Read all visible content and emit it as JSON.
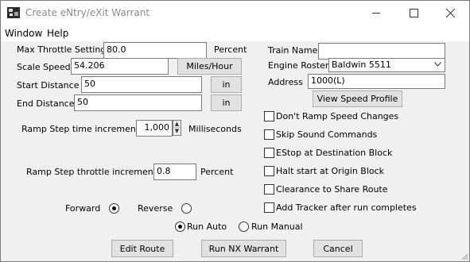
{
  "window": {
    "title": "Create eNtry/eXit Warrant"
  },
  "menu": [
    "Window",
    "Help"
  ],
  "throttle": {
    "label": "Max Throttle Setting",
    "value": "80.0",
    "unit": "Percent"
  },
  "scale_speed": {
    "label": "Scale Speed",
    "value": "54.206",
    "unit_button": "Miles/Hour"
  },
  "start_distance": {
    "label": "Start Distance",
    "value": "50",
    "unit_button": "in"
  },
  "end_distance": {
    "label": "End Distance",
    "value": "50",
    "unit_button": "in"
  },
  "ramp_time": {
    "label": "Ramp Step time increment:",
    "value": "1,000",
    "unit": "Milliseconds"
  },
  "ramp_throttle": {
    "label": "Ramp Step throttle increment:",
    "value": "0.8",
    "unit": "Percent"
  },
  "train_name": {
    "label": "Train Name",
    "value": ""
  },
  "engine_roster": {
    "label": "Engine Roster",
    "value": "Baldwin 5511"
  },
  "address": {
    "label": "Address",
    "value": "1000(L)"
  },
  "view_speed_profile": "View Speed Profile",
  "checkboxes": [
    {
      "label": "Don't Ramp Speed Changes",
      "checked": false
    },
    {
      "label": "Skip Sound Commands",
      "checked": false
    },
    {
      "label": "EStop at Destination Block",
      "checked": false
    },
    {
      "label": "Halt start at Origin Block",
      "checked": false
    },
    {
      "label": "Clearance to Share Route",
      "checked": false
    },
    {
      "label": "Add Tracker after run completes",
      "checked": false
    }
  ],
  "direction": {
    "forward": "Forward",
    "reverse": "Reverse",
    "selected": "forward"
  },
  "run_mode": {
    "auto": "Run Auto",
    "manual": "Run Manual",
    "selected": "auto"
  },
  "buttons": {
    "edit_route": "Edit Route",
    "run": "Run NX Warrant",
    "cancel": "Cancel"
  }
}
